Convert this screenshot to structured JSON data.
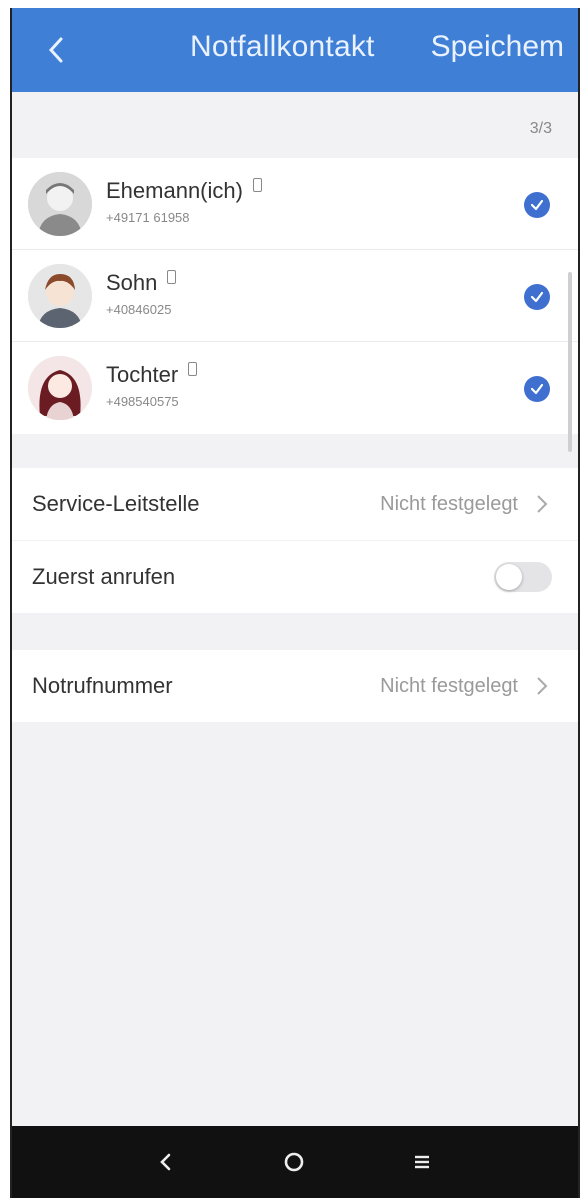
{
  "header": {
    "title": "Notfallkontakt",
    "save_label": "Speichem",
    "back_icon": "chevron-left-icon",
    "bg_color": "#3f7fd6"
  },
  "count": "3/3",
  "contacts": [
    {
      "name": "Ehemann(ich)",
      "number": "+49171 61958",
      "avatar": "man-gray-avatar",
      "selected": true
    },
    {
      "name": "Sohn",
      "number": "+40846025",
      "avatar": "boy-avatar",
      "selected": true
    },
    {
      "name": "Tochter",
      "number": "+498540575",
      "avatar": "girl-avatar",
      "selected": true
    }
  ],
  "settings": {
    "service_label": "Service-Leitstelle",
    "service_value": "Nicht festgelegt",
    "call_first_label": "Zuerst anrufen",
    "call_first_on": false,
    "emergency_label": "Notrufnummer",
    "emergency_value": "Nicht festgelegt"
  },
  "navbar": {
    "back": "back-triangle-icon",
    "home": "home-circle-icon",
    "menu": "menu-lines-icon"
  },
  "colors": {
    "accent": "#3f6fcf"
  }
}
